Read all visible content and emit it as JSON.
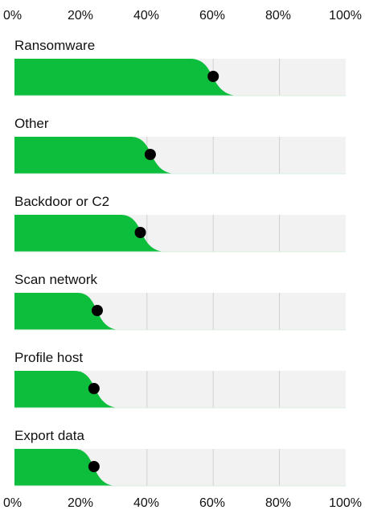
{
  "chart_data": {
    "type": "area",
    "x_ticks": [
      "0%",
      "20%",
      "40%",
      "60%",
      "80%",
      "100%"
    ],
    "xlim": [
      0,
      100
    ],
    "grid": true,
    "colors": {
      "fill": "#0dbd3c",
      "track": "#f2f2f2",
      "grid": "#cfcfcf",
      "marker": "#000000"
    },
    "panels": [
      {
        "label": "Ransomware",
        "marker": 60,
        "plateau_end": 53,
        "drop_end": 68
      },
      {
        "label": "Other",
        "marker": 41,
        "plateau_end": 35,
        "drop_end": 49
      },
      {
        "label": "Backdoor or C2",
        "marker": 38,
        "plateau_end": 32,
        "drop_end": 46
      },
      {
        "label": "Scan network",
        "marker": 25,
        "plateau_end": 19,
        "drop_end": 32
      },
      {
        "label": "Profile host",
        "marker": 24,
        "plateau_end": 18,
        "drop_end": 32
      },
      {
        "label": "Export data",
        "marker": 24,
        "plateau_end": 18,
        "drop_end": 31
      }
    ]
  }
}
